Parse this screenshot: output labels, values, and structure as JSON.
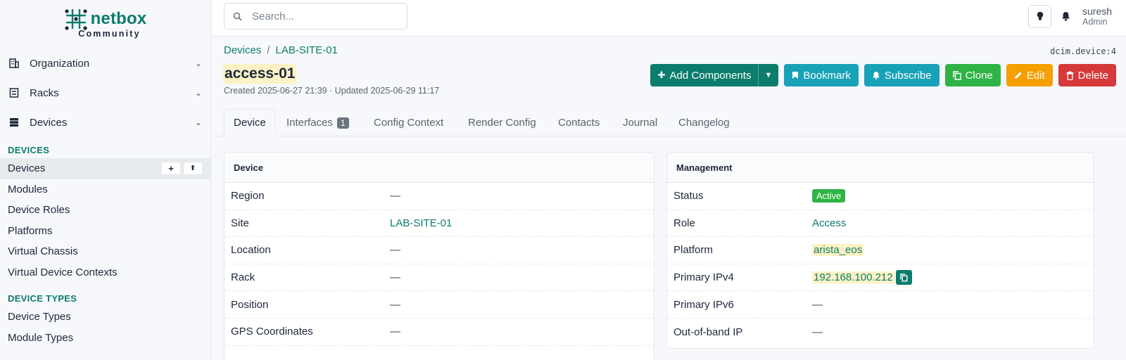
{
  "brand": {
    "name": "netbox",
    "edition": "Community"
  },
  "sidebar": {
    "groups": [
      {
        "label": "Organization"
      },
      {
        "label": "Racks"
      },
      {
        "label": "Devices"
      }
    ],
    "sections": [
      {
        "title": "DEVICES",
        "items": [
          {
            "label": "Devices"
          },
          {
            "label": "Modules"
          },
          {
            "label": "Device Roles"
          },
          {
            "label": "Platforms"
          },
          {
            "label": "Virtual Chassis"
          },
          {
            "label": "Virtual Device Contexts"
          }
        ]
      },
      {
        "title": "DEVICE TYPES",
        "items": [
          {
            "label": "Device Types"
          },
          {
            "label": "Module Types"
          }
        ]
      }
    ],
    "add_glyph": "+",
    "import_glyph": "⬆"
  },
  "topbar": {
    "search_placeholder": "Search...",
    "user": {
      "name": "suresh",
      "role": "Admin"
    }
  },
  "breadcrumb": {
    "items": [
      "Devices",
      "LAB-SITE-01"
    ],
    "separator": "/"
  },
  "object_id": "dcim.device:4",
  "page": {
    "title": "access-01",
    "dates": "Created 2025-06-27 21:39 · Updated 2025-06-29 11:17"
  },
  "actions": {
    "add_components": "Add Components",
    "bookmark": "Bookmark",
    "subscribe": "Subscribe",
    "clone": "Clone",
    "edit": "Edit",
    "delete": "Delete"
  },
  "tabs": [
    {
      "label": "Device"
    },
    {
      "label": "Interfaces",
      "count": "1"
    },
    {
      "label": "Config Context"
    },
    {
      "label": "Render Config"
    },
    {
      "label": "Contacts"
    },
    {
      "label": "Journal"
    },
    {
      "label": "Changelog"
    }
  ],
  "device_card": {
    "title": "Device",
    "rows": [
      {
        "key": "Region",
        "value": "—"
      },
      {
        "key": "Site",
        "value": "LAB-SITE-01"
      },
      {
        "key": "Location",
        "value": "—"
      },
      {
        "key": "Rack",
        "value": "—"
      },
      {
        "key": "Position",
        "value": "—"
      },
      {
        "key": "GPS Coordinates",
        "value": "—"
      }
    ]
  },
  "management_card": {
    "title": "Management",
    "rows": [
      {
        "key": "Status",
        "value": "Active"
      },
      {
        "key": "Role",
        "value": "Access"
      },
      {
        "key": "Platform",
        "value": "arista_eos"
      },
      {
        "key": "Primary IPv4",
        "value": "192.168.100.212"
      },
      {
        "key": "Primary IPv6",
        "value": "—"
      },
      {
        "key": "Out-of-band IP",
        "value": "—"
      }
    ]
  },
  "colors": {
    "brand": "#0c7c6c",
    "active": "#2fb344",
    "danger": "#d63939",
    "warning": "#f59f00",
    "info": "#17a2b8"
  }
}
